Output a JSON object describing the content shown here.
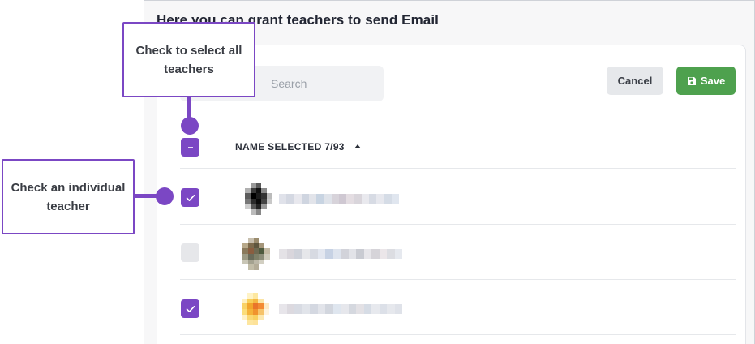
{
  "page": {
    "heading": "Here you can grant teachers to send Email"
  },
  "search": {
    "placeholder": "Search"
  },
  "toolbar": {
    "cancel_label": "Cancel",
    "save_label": "Save"
  },
  "table": {
    "column_header": "NAME SELECTED 7/93",
    "select_all_state": "indeterminate",
    "rows": [
      {
        "checked": true
      },
      {
        "checked": false
      },
      {
        "checked": true
      }
    ]
  },
  "annotations": {
    "select_all": "Check to select all teachers",
    "individual": "Check an individual teacher"
  },
  "colors": {
    "accent": "#7b47c4",
    "save": "#4ea14e",
    "cancel": "#e6e8eb"
  },
  "icons": {
    "save": "floppy-disk-icon",
    "sort": "caret-up-icon",
    "checkbox_checked": "checkmark-icon",
    "checkbox_partial": "minus-icon"
  }
}
